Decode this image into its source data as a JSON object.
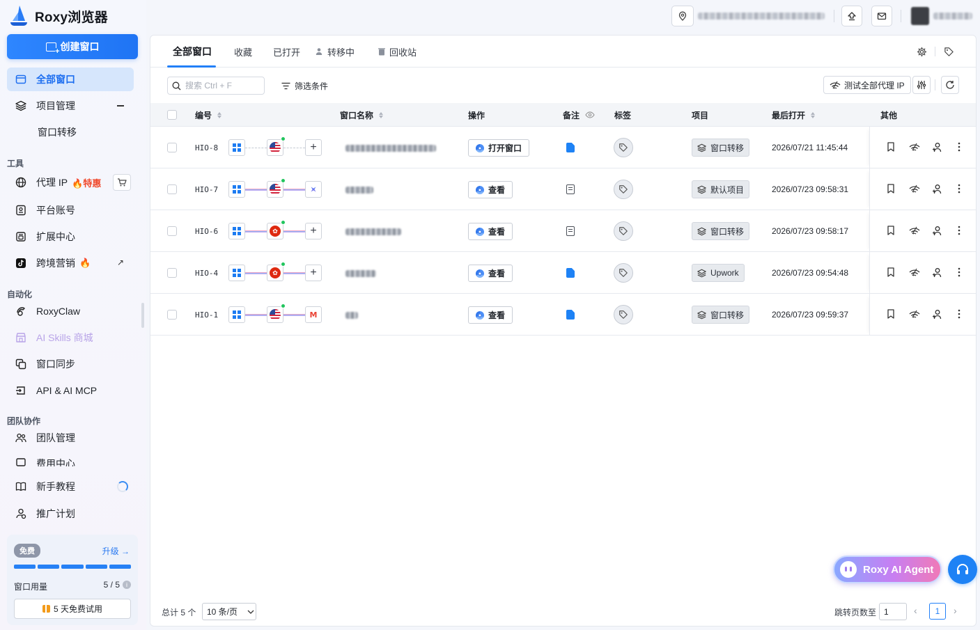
{
  "app": {
    "title": "Roxy浏览器"
  },
  "sidebar": {
    "create_label": "创建窗口",
    "nav": {
      "all_windows": "全部窗口",
      "project_mgmt": "项目管理",
      "window_transfer": "窗口转移",
      "section_tools": "工具",
      "proxy_ip": "代理 IP",
      "proxy_hot": "特惠",
      "platform_account": "平台账号",
      "extension_center": "扩展中心",
      "cross_border": "跨境营销",
      "section_automation": "自动化",
      "roxyclaw": "RoxyClaw",
      "ai_skills": "AI Skills 商城",
      "window_sync": "窗口同步",
      "api_mcp": "API & AI MCP",
      "section_team": "团队协作",
      "team_mgmt": "团队管理",
      "billing": "费用中心",
      "tutorial": "新手教程",
      "referral": "推广计划"
    },
    "plan": {
      "badge": "免费",
      "upgrade": "升级 →",
      "usage_label": "窗口用量",
      "usage_value": "5 / 5",
      "usage_fraction": 1.0,
      "trial_label": "5 天免费试用"
    }
  },
  "tabs": [
    {
      "label": "全部窗口",
      "active": true
    },
    {
      "label": "收藏"
    },
    {
      "label": "已打开"
    },
    {
      "label": "转移中",
      "icon": "user-transfer-icon"
    },
    {
      "label": "回收站",
      "icon": "trash-icon"
    }
  ],
  "toolbar": {
    "search_placeholder": "搜索 Ctrl + F",
    "filter_label": "筛选条件",
    "test_proxy_label": "测试全部代理 IP"
  },
  "table": {
    "columns": {
      "code": "编号",
      "name": "窗口名称",
      "action": "操作",
      "note": "备注",
      "tag": "标签",
      "project": "项目",
      "last_open": "最后打开",
      "other": "其他"
    },
    "rows": [
      {
        "code": "HIO-8",
        "flag": "us",
        "env_end": "plus",
        "linked": false,
        "action": "打开窗口",
        "note": "doc",
        "project": "窗口转移",
        "last_open": "2026/07/21 11:45:44"
      },
      {
        "code": "HIO-7",
        "flag": "us",
        "env_end": "gemini",
        "linked": true,
        "action": "查看",
        "note": "edit",
        "project": "默认项目",
        "last_open": "2026/07/23 09:58:31"
      },
      {
        "code": "HIO-6",
        "flag": "hk",
        "env_end": "plus",
        "linked": true,
        "action": "查看",
        "note": "edit",
        "project": "窗口转移",
        "last_open": "2026/07/23 09:58:17"
      },
      {
        "code": "HIO-4",
        "flag": "hk",
        "env_end": "plus",
        "linked": true,
        "action": "查看",
        "note": "doc",
        "project": "Upwork",
        "last_open": "2026/07/23 09:54:48"
      },
      {
        "code": "HIO-1",
        "flag": "us",
        "env_end": "gmail",
        "linked": true,
        "action": "查看",
        "note": "doc",
        "project": "窗口转移",
        "last_open": "2026/07/23 09:59:37"
      }
    ]
  },
  "pagination": {
    "total": "总计 5 个",
    "page_size": "10 条/页",
    "jump_label": "跳转页数至",
    "jump_value": "1",
    "current_page": "1"
  },
  "floating": {
    "ai_agent": "Roxy AI Agent"
  },
  "colors": {
    "accent": "#2280f8",
    "hot": "#f0492c",
    "online": "#22c55e"
  }
}
